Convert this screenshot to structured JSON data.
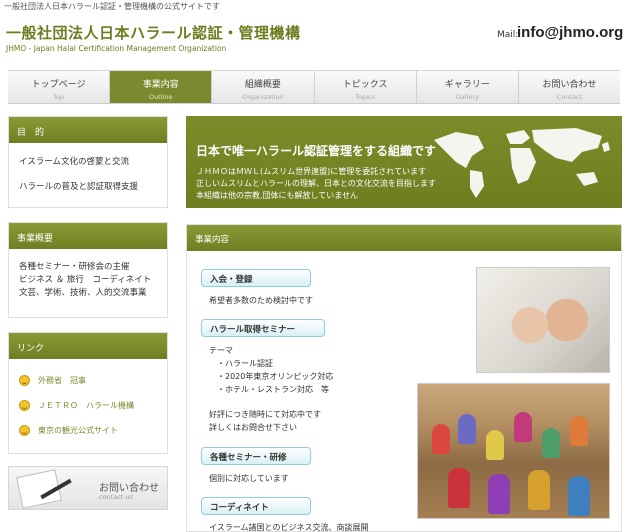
{
  "header": {
    "top_note": "一般社団法人日本ハラール認証・管理機構の公式サイトです",
    "title": "一般社団法人日本ハラール認証・管理機構",
    "subtitle": "JHMO - Japan Halal Certification Management Organization",
    "mail_label": "Mail:",
    "mail_address": "info@jhmo.org"
  },
  "nav": [
    {
      "jp": "トップページ",
      "en": "Top",
      "active": false
    },
    {
      "jp": "事業内容",
      "en": "Outline",
      "active": true
    },
    {
      "jp": "組織概要",
      "en": "Organization",
      "active": false
    },
    {
      "jp": "トピックス",
      "en": "Topics",
      "active": false
    },
    {
      "jp": "ギャラリー",
      "en": "Gallery",
      "active": false
    },
    {
      "jp": "お問い合わせ",
      "en": "Contact",
      "active": false
    }
  ],
  "sidebar": {
    "purpose": {
      "heading": "目　的",
      "items": [
        "イスラーム文化の啓蒙と交流",
        "ハラールの普及と認証取得支援"
      ]
    },
    "business": {
      "heading": "事業概要",
      "lines": [
        "各種セミナー・研修会の主催",
        "ビジネス ＆ 旅行　コーディネイト",
        "文芸、学術、技術、人的交流事業"
      ]
    },
    "links": {
      "heading": "リンク",
      "items": [
        "外務省　冠事",
        "ＪＥＴＲＯ　ハラール機構",
        "東京の観光公式サイト"
      ]
    },
    "contact": {
      "jp": "お問い合わせ",
      "en": "contact us"
    }
  },
  "hero": {
    "title": "日本で唯一ハラール認証管理をする組織です",
    "lines": [
      "ＪＨＭＯはＭＷＬ(ムスリム世界連盟)に管理を委託されています",
      "正しいムスリムとハラールの理解、日本との文化交流を目指します",
      "本組織は他の宗教,団体にも解放していません"
    ]
  },
  "main": {
    "heading": "事業内容",
    "sections": [
      {
        "label": "入会・登録",
        "lines": [
          "希望者多数のため検討中です"
        ]
      },
      {
        "label": "ハラール取得セミナー",
        "lines": [
          "テーマ",
          "・ハラール認証",
          "・2020年東京オリンピック対応",
          "・ホテル・レストラン対応　等"
        ]
      },
      {
        "label": "",
        "lines": [
          "好評につき随時にて対応中です",
          "詳しくはお問合せ下さい"
        ]
      },
      {
        "label": "各種セミナー・研修",
        "lines": [
          "個別に対応しています"
        ]
      },
      {
        "label": "コーディネイト",
        "lines": [
          "イスラーム諸国とのビジネス交流、商談展開"
        ]
      }
    ]
  },
  "colors": {
    "accent": "#7b8a2e",
    "title_green": "#6b7d1e",
    "pill_border": "#8ecfdc"
  }
}
